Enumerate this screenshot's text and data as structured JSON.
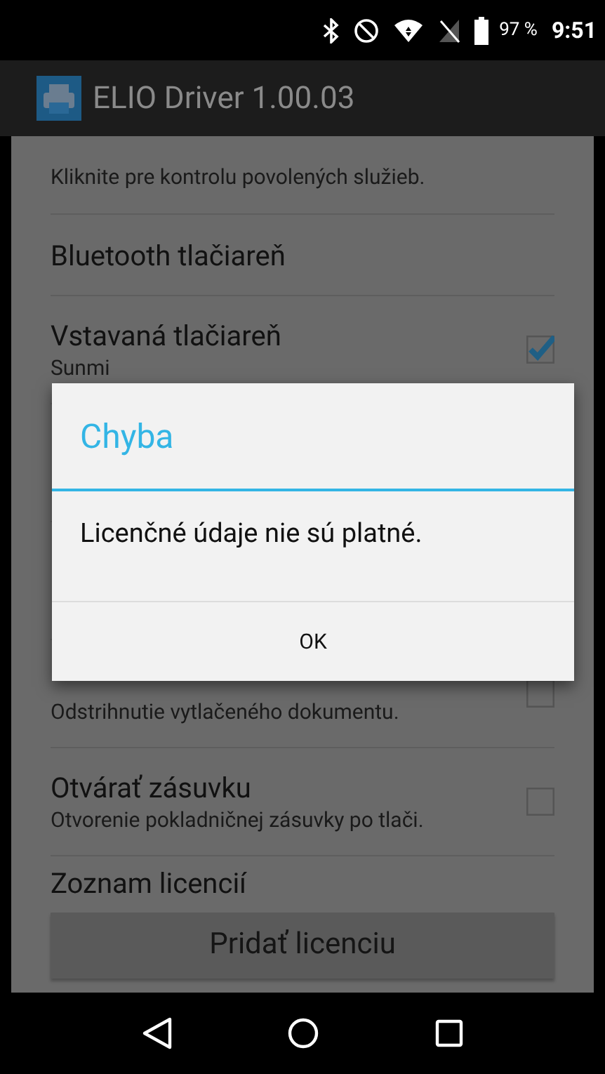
{
  "status_bar": {
    "battery": "97 %",
    "time": "9:51"
  },
  "app_bar": {
    "title": "ELIO Driver 1.00.03"
  },
  "settings": [
    {
      "kind": "note",
      "summary": "Kliknite pre kontrolu povolených služieb."
    },
    {
      "kind": "link",
      "title": "Bluetooth tlačiareň"
    },
    {
      "kind": "checkbox",
      "title": "Vstavaná tlačiareň",
      "summary": "Sunmi",
      "checked": true
    },
    {
      "kind": "hidden"
    },
    {
      "kind": "hidden"
    },
    {
      "kind": "checkbox",
      "summary": "Odstrihnutie vytlačeného dokumentu.",
      "checked": false
    },
    {
      "kind": "checkbox",
      "title": "Otvárať zásuvku",
      "summary": "Otvorenie pokladničnej zásuvky po tlači.",
      "checked": false
    },
    {
      "kind": "header",
      "title": "Zoznam licencií"
    }
  ],
  "add_button": "Pridať licenciu",
  "dialog": {
    "title": "Chyba",
    "message": "Licenčné údaje nie sú platné.",
    "button": "OK"
  }
}
